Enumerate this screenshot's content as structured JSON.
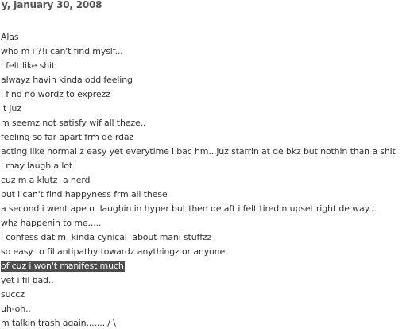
{
  "post": {
    "date": "y, January 30, 2008",
    "lines": [
      "Alas",
      "who m i ?!i can't find myslf...",
      "i felt like shit",
      "alwayz havin kinda odd feeling",
      "i find no wordz to exprezz",
      "it juz",
      "m seemz not satisfy wif all theze..",
      "feeling so far apart frm de rdaz",
      "acting like normal z easy yet everytime i bac hm...juz starrin at de bkz but nothin than a shit",
      "i may laugh a lot",
      "cuz m a klutz  a nerd",
      "but i can't find happyness frm all these",
      "a second i went ape n  laughin in hyper but then de aft i felt tired n upset right de way...",
      "whz happenin to me.....",
      "i confess dat m  kinda cynical  about mani stuffzz",
      "so easy to fil antipathy towardz anythingz or anyone",
      "of cuz i won't manifest much",
      "yet i fil bad..",
      "succz",
      "uh-oh..",
      "m talkin trash again......../ \\"
    ],
    "highlight_color": "#4d4d4d"
  }
}
